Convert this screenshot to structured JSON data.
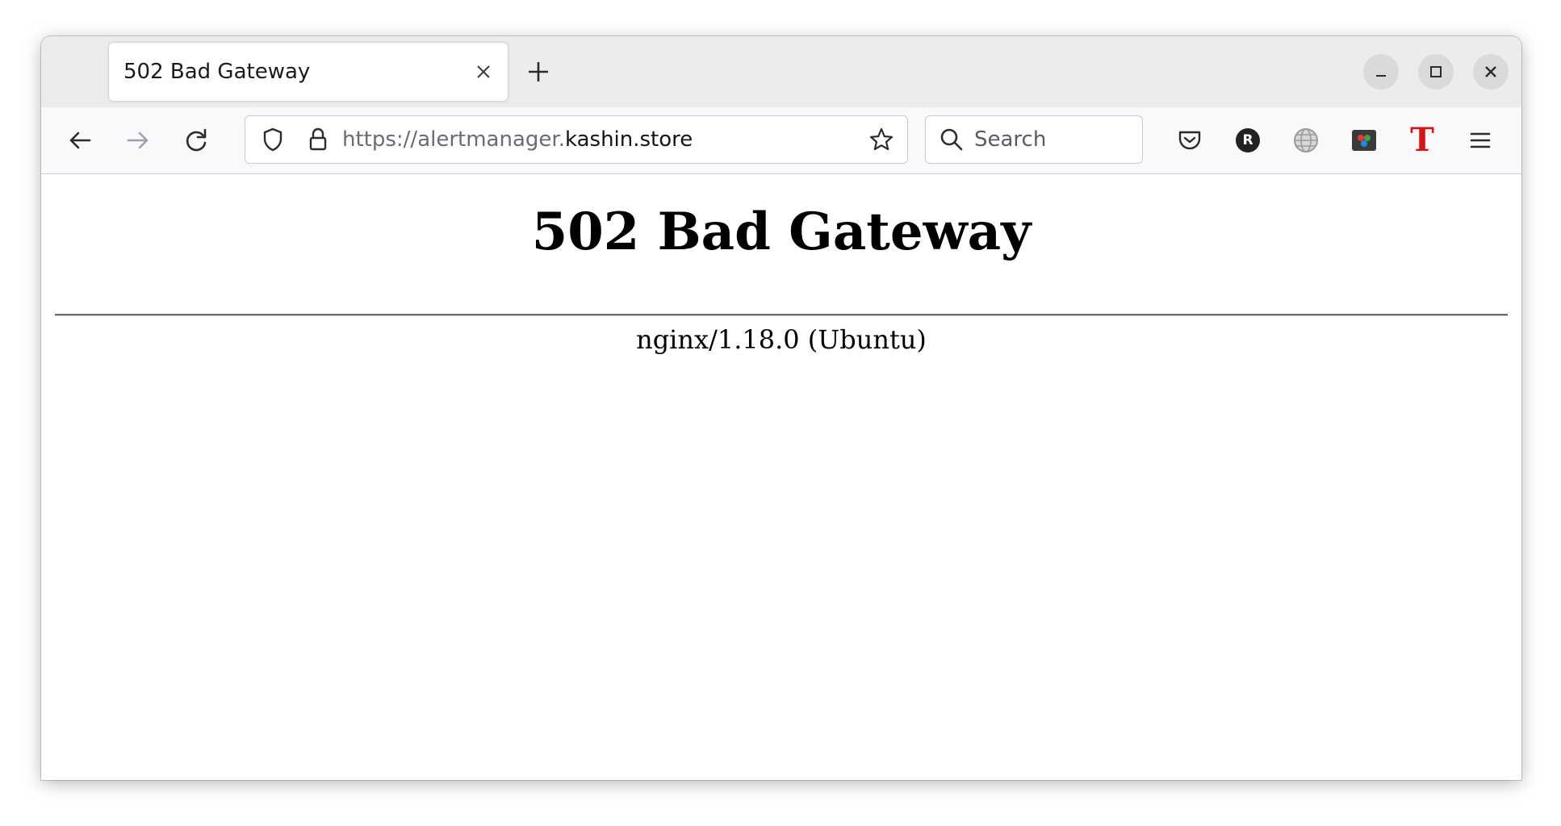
{
  "browser": {
    "tab": {
      "title": "502 Bad Gateway"
    },
    "address_bar": {
      "url_prefix": "https://alertmanager.",
      "url_domain": "kashin.store"
    },
    "search_bar": {
      "placeholder": "Search"
    },
    "toolbar_icons": [
      "pocket-icon",
      "profile-r-icon",
      "globe-extension-icon",
      "color-extension-icon",
      "t-extension-icon",
      "hamburger-menu-icon"
    ],
    "extension_badge_letter": "R",
    "extension_t_letter": "T"
  },
  "page": {
    "title": "502 Bad Gateway",
    "server_signature": "nginx/1.18.0 (Ubuntu)"
  },
  "colors": {
    "accent_t": "#d51616",
    "tabbar_bg": "#ececec",
    "navbar_bg": "#f9f9fb"
  }
}
